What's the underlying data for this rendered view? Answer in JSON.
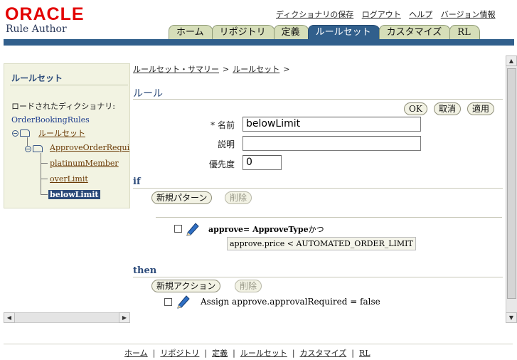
{
  "header": {
    "logo_text": "ORACLE",
    "app_name": "Rule Author",
    "global_links": [
      "ディクショナリの保存",
      "ログアウト",
      "ヘルプ",
      "バージョン情報"
    ],
    "tabs": [
      {
        "label": "ホーム",
        "active": false
      },
      {
        "label": "リポジトリ",
        "active": false
      },
      {
        "label": "定義",
        "active": false
      },
      {
        "label": "ルールセット",
        "active": true
      },
      {
        "label": "カスタマイズ",
        "active": false
      },
      {
        "label": "RL",
        "active": false
      }
    ],
    "brand_color": "#e30000",
    "accent_color": "#315f8c"
  },
  "left_panel": {
    "title": "ルールセット",
    "dictionary_label": "ロードされたディクショナリ:",
    "dictionary_name": "OrderBookingRules",
    "tree": [
      {
        "label": "ルールセット",
        "selected": false
      },
      {
        "label": "ApproveOrderRequir",
        "selected": false
      },
      {
        "label": "platinumMember",
        "selected": false
      },
      {
        "label": "overLimit",
        "selected": false
      },
      {
        "label": "belowLimit",
        "selected": true
      }
    ]
  },
  "breadcrumb": {
    "items": [
      "ルールセット・サマリー",
      "ルールセット"
    ],
    "separator": ">"
  },
  "rule": {
    "section_title": "ルール",
    "buttons": {
      "ok": "OK",
      "cancel": "取消",
      "apply": "適用"
    },
    "fields": {
      "name_label": "* 名前",
      "name_value": "belowLimit",
      "desc_label": "説明",
      "desc_value": "",
      "priority_label": "優先度",
      "priority_value": "0"
    }
  },
  "if_section": {
    "keyword": "if",
    "new_button": "新規パターン",
    "delete_button": "削除",
    "pattern_var": "approve",
    "pattern_rest": "= ApproveType",
    "pattern_suffix": "かつ",
    "test": "approve.price < AUTOMATED_ORDER_LIMIT"
  },
  "then_section": {
    "keyword": "then",
    "new_button": "新規アクション",
    "delete_button": "削除",
    "action": "Assign approve.approvalRequired = false"
  },
  "footer": {
    "links": [
      "ホーム",
      "リポジトリ",
      "定義",
      "ルールセット",
      "カスタマイズ",
      "RL"
    ],
    "separator": "|"
  }
}
